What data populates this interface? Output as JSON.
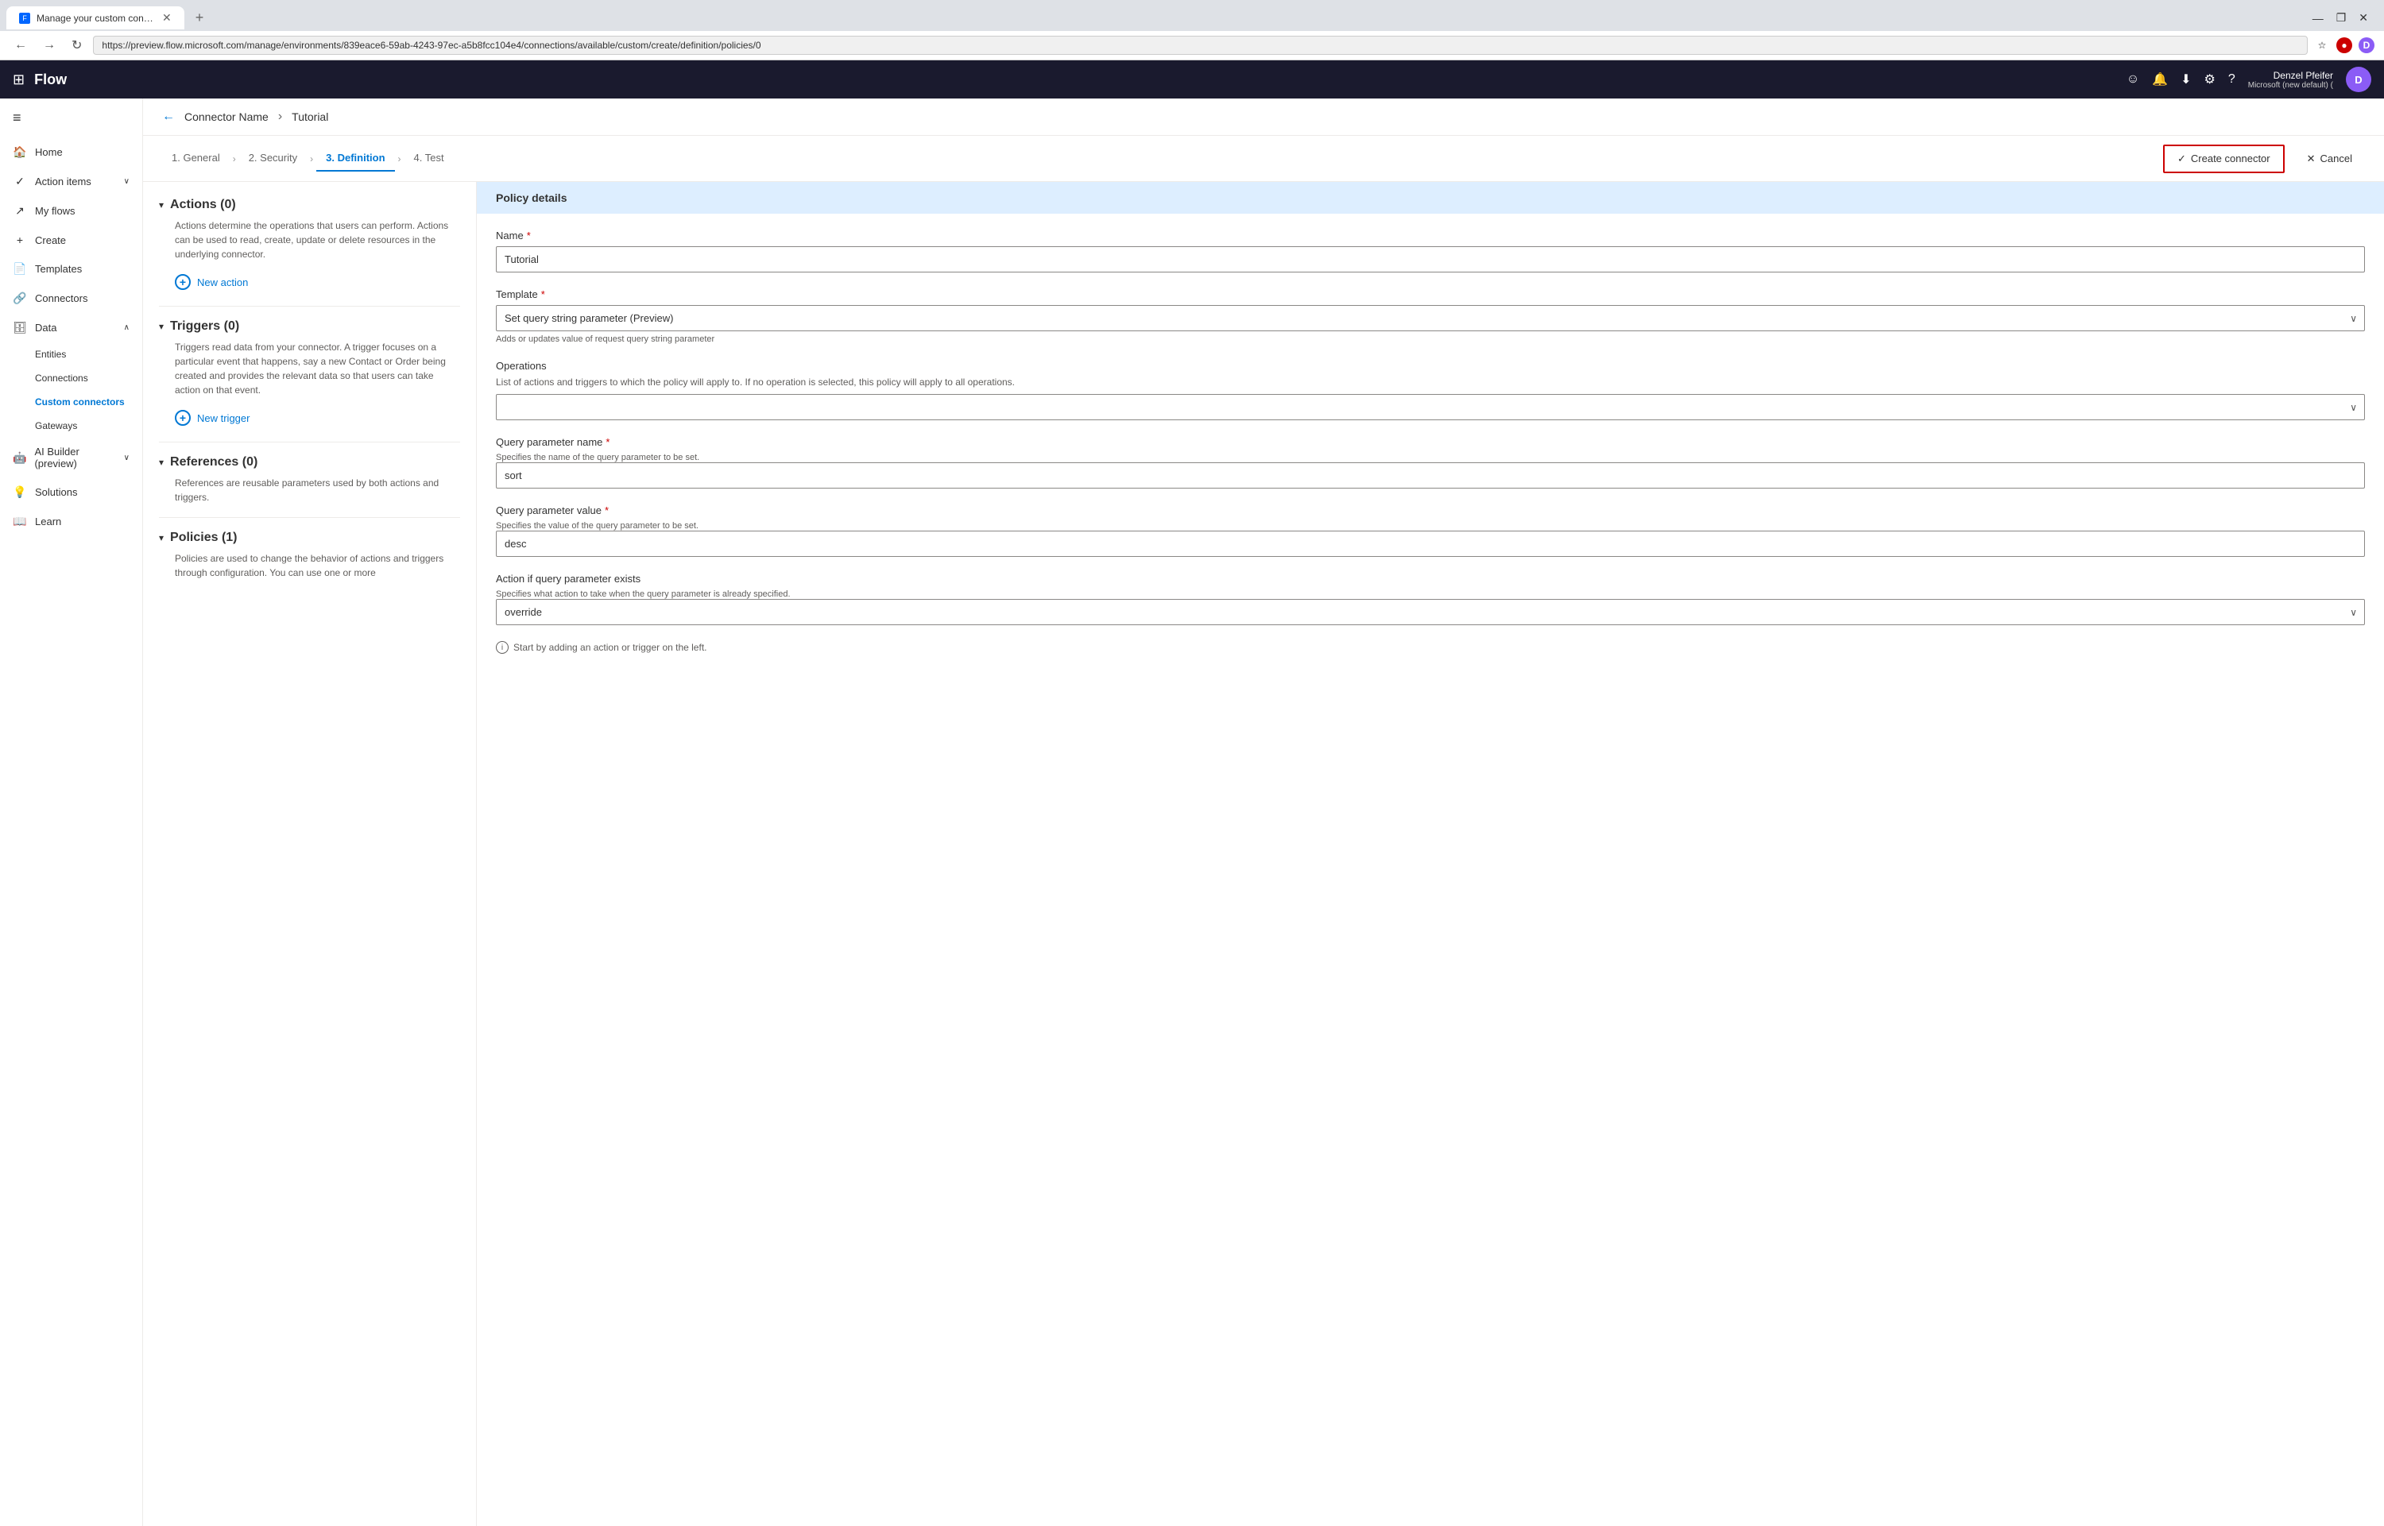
{
  "browser": {
    "tab_title": "Manage your custom connector...",
    "tab_favicon": "F",
    "url": "https://preview.flow.microsoft.com/manage/environments/839eace6-59ab-4243-97ec-a5b8fcc104e4/connections/available/custom/create/definition/policies/0",
    "new_tab_label": "+",
    "nav_back": "←",
    "nav_forward": "→",
    "nav_refresh": "↻",
    "window_minimize": "—",
    "window_maximize": "❐",
    "window_close": "✕"
  },
  "app": {
    "waffle_icon": "⊞",
    "brand": "Flow",
    "icons": [
      "☺",
      "🔔",
      "⬇",
      "⚙",
      "?"
    ],
    "user_name": "Denzel Pfeifer",
    "user_org": "Microsoft (new default) (",
    "avatar_initials": "D"
  },
  "sidebar": {
    "hamburger": "≡",
    "items": [
      {
        "id": "home",
        "icon": "🏠",
        "label": "Home",
        "has_chevron": false
      },
      {
        "id": "action-items",
        "icon": "✓",
        "label": "Action items",
        "has_chevron": true
      },
      {
        "id": "my-flows",
        "icon": "↗",
        "label": "My flows",
        "has_chevron": false
      },
      {
        "id": "create",
        "icon": "+",
        "label": "Create",
        "has_chevron": false
      },
      {
        "id": "templates",
        "icon": "📄",
        "label": "Templates",
        "has_chevron": false
      },
      {
        "id": "connectors",
        "icon": "🔗",
        "label": "Connectors",
        "has_chevron": false
      },
      {
        "id": "data",
        "icon": "🗄",
        "label": "Data",
        "has_chevron": true
      }
    ],
    "data_children": [
      {
        "id": "entities",
        "label": "Entities"
      },
      {
        "id": "connections",
        "label": "Connections"
      },
      {
        "id": "custom-connectors",
        "label": "Custom connectors",
        "active": true
      },
      {
        "id": "gateways",
        "label": "Gateways"
      }
    ],
    "bottom_items": [
      {
        "id": "ai-builder",
        "icon": "🤖",
        "label": "AI Builder (preview)",
        "has_chevron": true
      },
      {
        "id": "solutions",
        "icon": "💡",
        "label": "Solutions",
        "has_chevron": false
      },
      {
        "id": "learn",
        "icon": "📖",
        "label": "Learn",
        "has_chevron": false
      }
    ]
  },
  "topbar": {
    "back_icon": "←",
    "connector_name_label": "Connector Name",
    "connector_name_value": "Tutorial"
  },
  "steps": {
    "tabs": [
      {
        "id": "general",
        "label": "1. General",
        "active": false
      },
      {
        "id": "security",
        "label": "2. Security",
        "active": false
      },
      {
        "id": "definition",
        "label": "3. Definition",
        "active": true
      },
      {
        "id": "test",
        "label": "4. Test",
        "active": false
      }
    ],
    "create_connector_label": "Create connector",
    "cancel_label": "Cancel"
  },
  "left_panel": {
    "actions": {
      "title": "Actions (0)",
      "desc": "Actions determine the operations that users can perform. Actions can be used to read, create, update or delete resources in the underlying connector.",
      "new_action_label": "New action"
    },
    "triggers": {
      "title": "Triggers (0)",
      "desc": "Triggers read data from your connector. A trigger focuses on a particular event that happens, say a new Contact or Order being created and provides the relevant data so that users can take action on that event.",
      "new_trigger_label": "New trigger"
    },
    "references": {
      "title": "References (0)",
      "desc": "References are reusable parameters used by both actions and triggers."
    },
    "policies": {
      "title": "Policies (1)",
      "desc": "Policies are used to change the behavior of actions and triggers through configuration. You can use one or more"
    }
  },
  "right_panel": {
    "header": "Policy details",
    "fields": {
      "name_label": "Name",
      "name_required": "*",
      "name_value": "Tutorial",
      "template_label": "Template",
      "template_required": "*",
      "template_value": "Set query string parameter (Preview)",
      "template_hint": "Adds or updates value of request query string parameter",
      "operations_label": "Operations",
      "operations_desc": "List of actions and triggers to which the policy will apply to. If no operation is selected, this policy will apply to all operations.",
      "operations_value": "",
      "query_param_name_label": "Query parameter name",
      "query_param_name_required": "*",
      "query_param_name_hint": "Specifies the name of the query parameter to be set.",
      "query_param_name_value": "sort",
      "query_param_value_label": "Query parameter value",
      "query_param_value_required": "*",
      "query_param_value_hint": "Specifies the value of the query parameter to be set.",
      "query_param_value_value": "desc",
      "action_if_exists_label": "Action if query parameter exists",
      "action_if_exists_hint": "Specifies what action to take when the query parameter is already specified.",
      "action_if_exists_value": "override"
    },
    "start_hint": "Start by adding an action or trigger on the left."
  }
}
